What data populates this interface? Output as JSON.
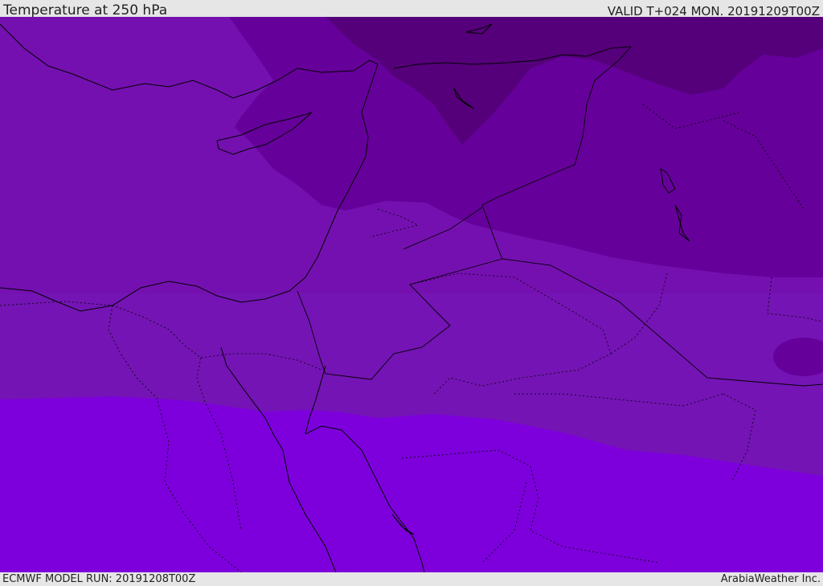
{
  "header": {
    "title": "Temperature at 250 hPa",
    "valid": "VALID T+024 MON. 20191209T00Z"
  },
  "footer": {
    "model_run": "ECMWF MODEL RUN: 20191208T00Z",
    "credit": "ArabiaWeather Inc."
  },
  "colors": {
    "band_coldest": "#55007a",
    "band_cold": "#66009a",
    "band_mid": "#7510b0",
    "band_warm": "#7c16c4",
    "band_warmest": "#7d00dc",
    "outline": "#000000",
    "bar": "#e6e6e6"
  }
}
